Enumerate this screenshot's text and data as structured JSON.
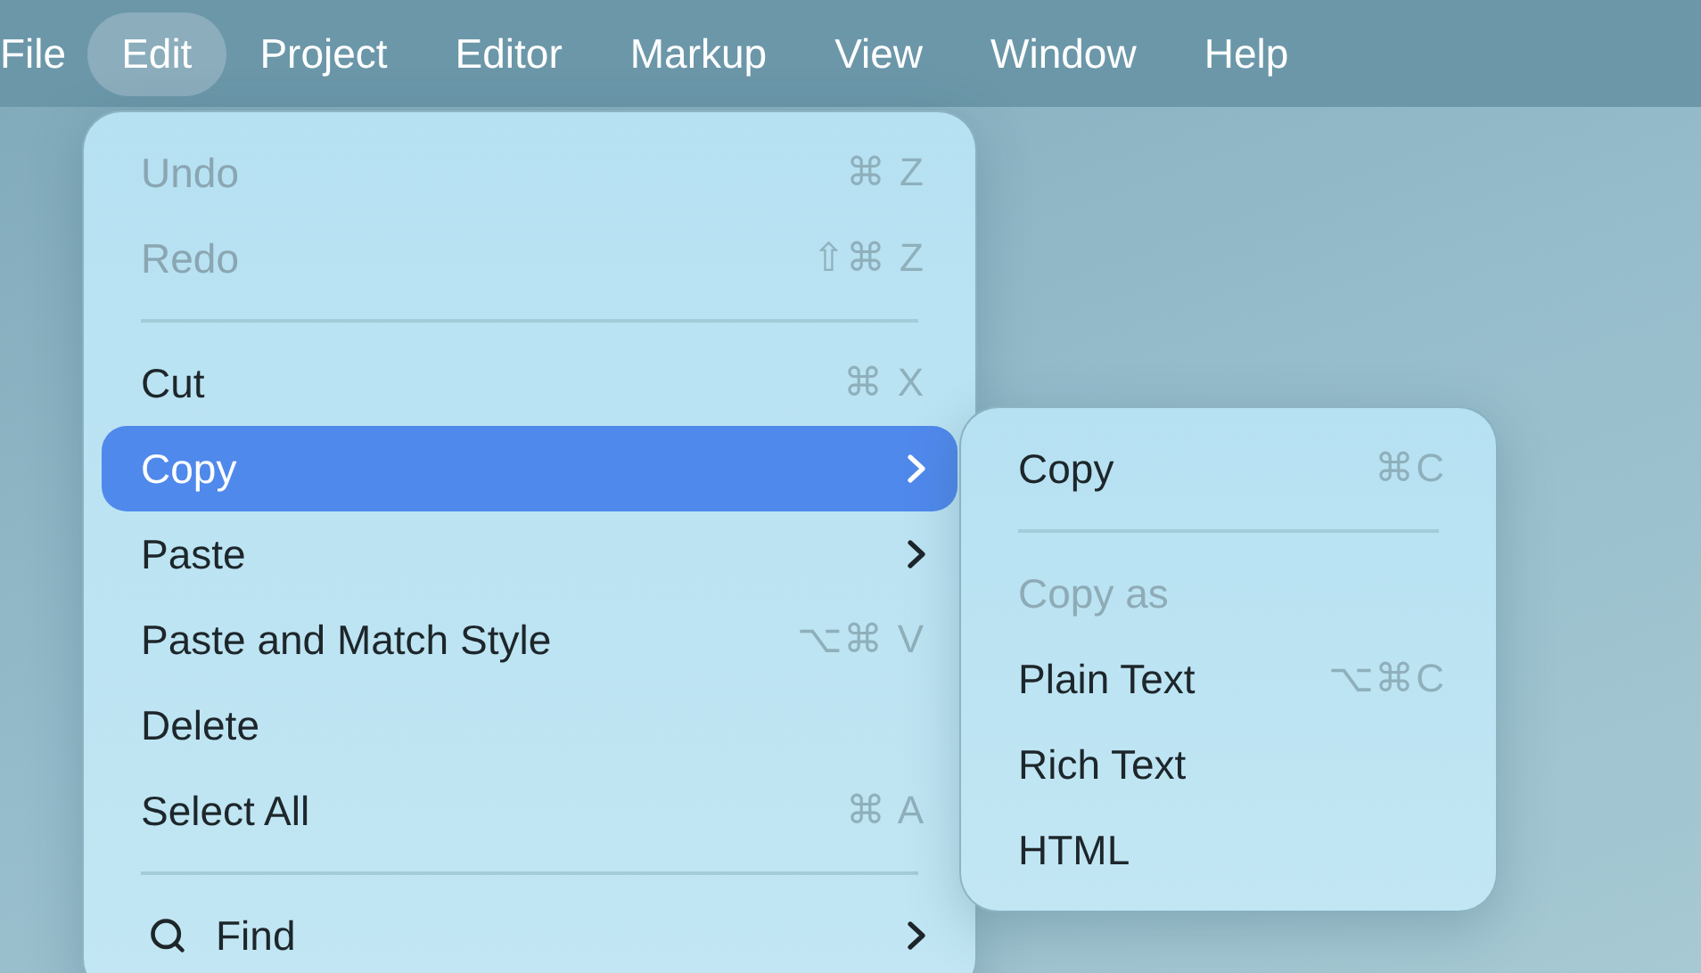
{
  "menubar": {
    "items": [
      {
        "label": "File",
        "selected": false
      },
      {
        "label": "Edit",
        "selected": true
      },
      {
        "label": "Project",
        "selected": false
      },
      {
        "label": "Editor",
        "selected": false
      },
      {
        "label": "Markup",
        "selected": false
      },
      {
        "label": "View",
        "selected": false
      },
      {
        "label": "Window",
        "selected": false
      },
      {
        "label": "Help",
        "selected": false
      }
    ]
  },
  "edit_menu": {
    "items": [
      {
        "kind": "item",
        "label": "Undo",
        "shortcut": "⌘ Z",
        "disabled": true,
        "selected": false,
        "submenu": false
      },
      {
        "kind": "item",
        "label": "Redo",
        "shortcut": "⇧⌘ Z",
        "disabled": true,
        "selected": false,
        "submenu": false
      },
      {
        "kind": "separator"
      },
      {
        "kind": "item",
        "label": "Cut",
        "shortcut": "⌘ X",
        "disabled": false,
        "selected": false,
        "submenu": false
      },
      {
        "kind": "item",
        "label": "Copy",
        "disabled": false,
        "selected": true,
        "submenu": true
      },
      {
        "kind": "item",
        "label": "Paste",
        "disabled": false,
        "selected": false,
        "submenu": true
      },
      {
        "kind": "item",
        "label": "Paste and Match Style",
        "shortcut": "⌥⌘ V",
        "disabled": false,
        "selected": false,
        "submenu": false
      },
      {
        "kind": "item",
        "label": "Delete",
        "disabled": false,
        "selected": false,
        "submenu": false
      },
      {
        "kind": "item",
        "label": "Select All",
        "shortcut": "⌘ A",
        "disabled": false,
        "selected": false,
        "submenu": false
      },
      {
        "kind": "separator"
      },
      {
        "kind": "search",
        "label": "Find",
        "disabled": false,
        "selected": false,
        "submenu": true
      }
    ]
  },
  "copy_submenu": {
    "items": [
      {
        "kind": "item",
        "label": "Copy",
        "shortcut": "⌘C",
        "disabled": false,
        "selected": false,
        "submenu": false
      },
      {
        "kind": "separator"
      },
      {
        "kind": "header",
        "label": "Copy as"
      },
      {
        "kind": "item",
        "label": "Plain Text",
        "shortcut": "⌥⌘C",
        "disabled": false,
        "selected": false,
        "submenu": false
      },
      {
        "kind": "item",
        "label": "Rich Text",
        "disabled": false,
        "selected": false,
        "submenu": false
      },
      {
        "kind": "item",
        "label": "HTML",
        "disabled": false,
        "selected": false,
        "submenu": false
      }
    ]
  }
}
